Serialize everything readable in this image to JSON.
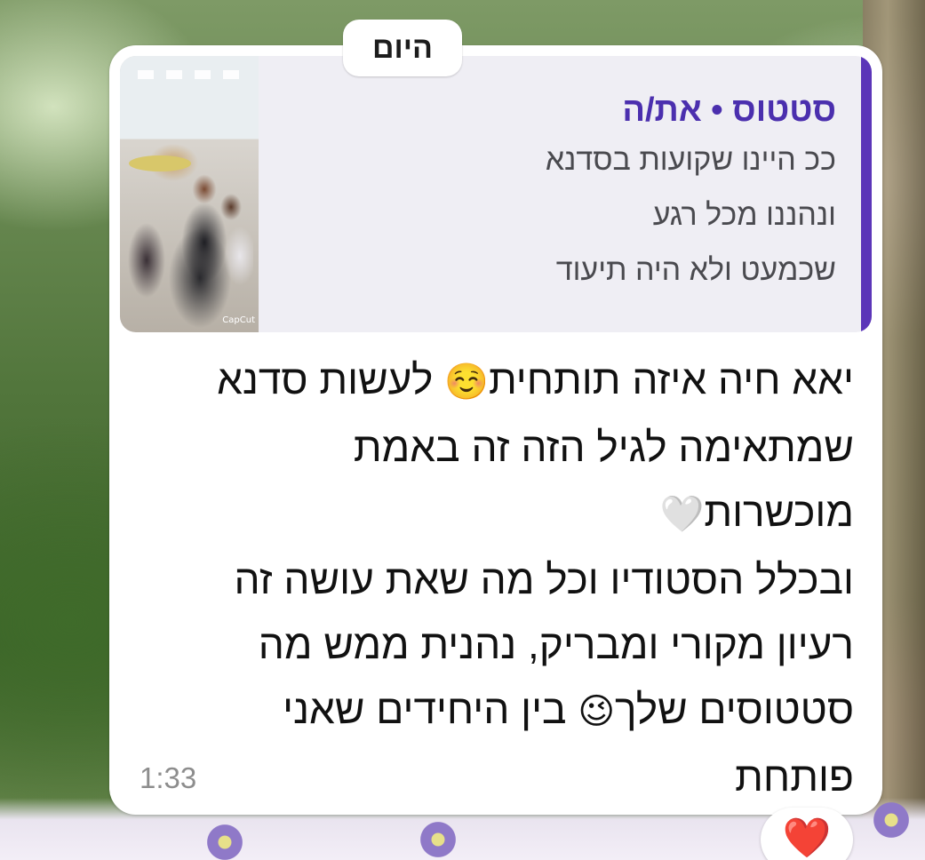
{
  "date_divider": "היום",
  "quoted_status": {
    "title": "סטטוס • את/ה",
    "lines": [
      "ככ היינו שקועות בסדנא",
      "ונהננו מכל רגע",
      "שכמעט ולא היה תיעוד"
    ],
    "thumbnail_watermark": "CapCut"
  },
  "message": {
    "line1_before_emoji": "יאא חיה איזה תותחית",
    "emoji_1": "☺️",
    "line1_after_emoji": " לעשות סדנא",
    "line2": "שמתאימה לגיל הזה זה באמת",
    "line3": "מוכשרות",
    "emoji_2": "🤍",
    "line4": "ובכלל הסטודיו וכל מה שאת עושה זה",
    "line5": "רעיון מקורי ומבריק, נהנית ממש מה",
    "line6_before_emoji": "סטטוסים שלך",
    "emoji_3": "😉",
    "line6_after_emoji": " בין היחידים שאני",
    "line7": "פותחת"
  },
  "timestamp": "1:33",
  "reaction": "❤️",
  "icons": [
    "heart-reaction-icon",
    "smiling-face-emoji",
    "white-heart-emoji",
    "winking-face-emoji"
  ]
}
